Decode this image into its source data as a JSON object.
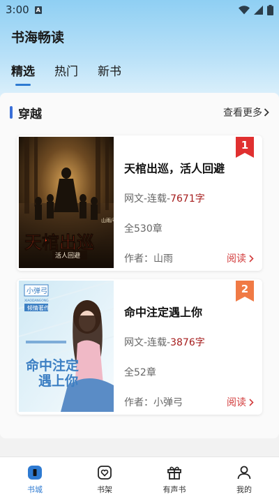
{
  "status_bar": {
    "time": "3:00",
    "a_icon": "A"
  },
  "app": {
    "title": "书海畅读"
  },
  "tabs": [
    {
      "label": "精选",
      "active": true
    },
    {
      "label": "热门",
      "active": false
    },
    {
      "label": "新书",
      "active": false
    }
  ],
  "section": {
    "title": "穿越",
    "see_more": "查看更多",
    "accent": "#3a6fd8"
  },
  "books": [
    {
      "rank": "1",
      "title": "天棺出巡，活人回避",
      "type_prefix": "网文-连载-",
      "word_count": "7671字",
      "chapters": "全530章",
      "author": "作者：山雨",
      "read_label": "阅读",
      "cover_title": "天棺出巡",
      "cover_subtitle": "活人回避",
      "cover_author": "山雨/著"
    },
    {
      "rank": "2",
      "title": "命中注定遇上你",
      "type_prefix": "网文-连载-",
      "word_count": "3876字",
      "chapters": "全52章",
      "author": "作者：小弹弓",
      "read_label": "阅读",
      "cover_author": "小弹弓",
      "cover_pinyin": "XIAODANGONG",
      "cover_tag": "倾情著作",
      "cover_title_1": "命中注定",
      "cover_title_2": "遇上你"
    }
  ],
  "bottom_nav": [
    {
      "label": "书城",
      "icon": "bookstore-icon",
      "active": true
    },
    {
      "label": "书架",
      "icon": "bookshelf-heart-icon",
      "active": false
    },
    {
      "label": "有声书",
      "icon": "gift-box-icon",
      "active": false
    },
    {
      "label": "我的",
      "icon": "user-icon",
      "active": false
    }
  ],
  "colors": {
    "brand_blue": "#2e7ad1",
    "word_count": "#a51c1c",
    "read_link": "#d23b3b",
    "badge_1": "#e03030",
    "badge_2": "#f07a45"
  }
}
